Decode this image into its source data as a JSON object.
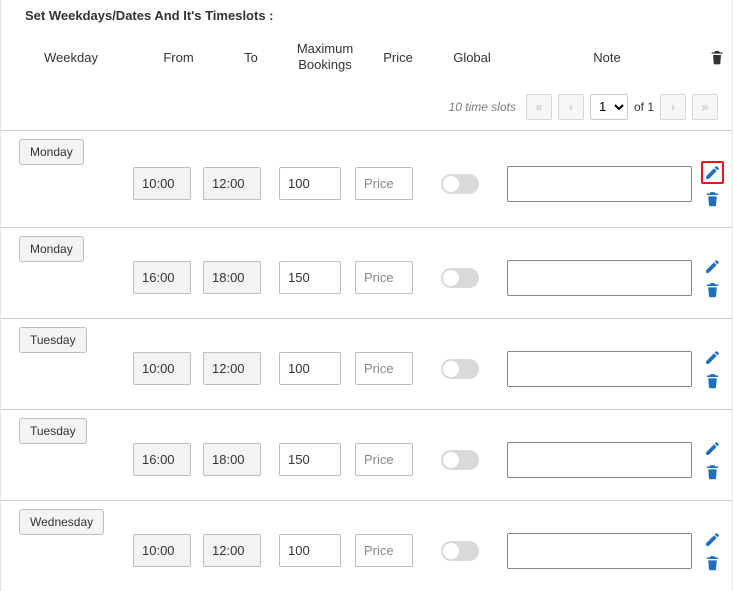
{
  "title": "Set Weekdays/Dates And It's Timeslots :",
  "headers": {
    "weekday": "Weekday",
    "from": "From",
    "to": "To",
    "max": "Maximum Bookings",
    "price": "Price",
    "global": "Global",
    "note": "Note"
  },
  "pager": {
    "info": "10 time slots",
    "page": "1",
    "of_label": "of 1"
  },
  "placeholders": {
    "price": "Price"
  },
  "rows": [
    {
      "day": "Monday",
      "from": "10:00",
      "to": "12:00",
      "max": "100",
      "price": "",
      "global": false,
      "note": "",
      "edit_highlight": true
    },
    {
      "day": "Monday",
      "from": "16:00",
      "to": "18:00",
      "max": "150",
      "price": "",
      "global": false,
      "note": "",
      "edit_highlight": false
    },
    {
      "day": "Tuesday",
      "from": "10:00",
      "to": "12:00",
      "max": "100",
      "price": "",
      "global": false,
      "note": "",
      "edit_highlight": false
    },
    {
      "day": "Tuesday",
      "from": "16:00",
      "to": "18:00",
      "max": "150",
      "price": "",
      "global": false,
      "note": "",
      "edit_highlight": false
    },
    {
      "day": "Wednesday",
      "from": "10:00",
      "to": "12:00",
      "max": "100",
      "price": "",
      "global": false,
      "note": "",
      "edit_highlight": false
    }
  ]
}
